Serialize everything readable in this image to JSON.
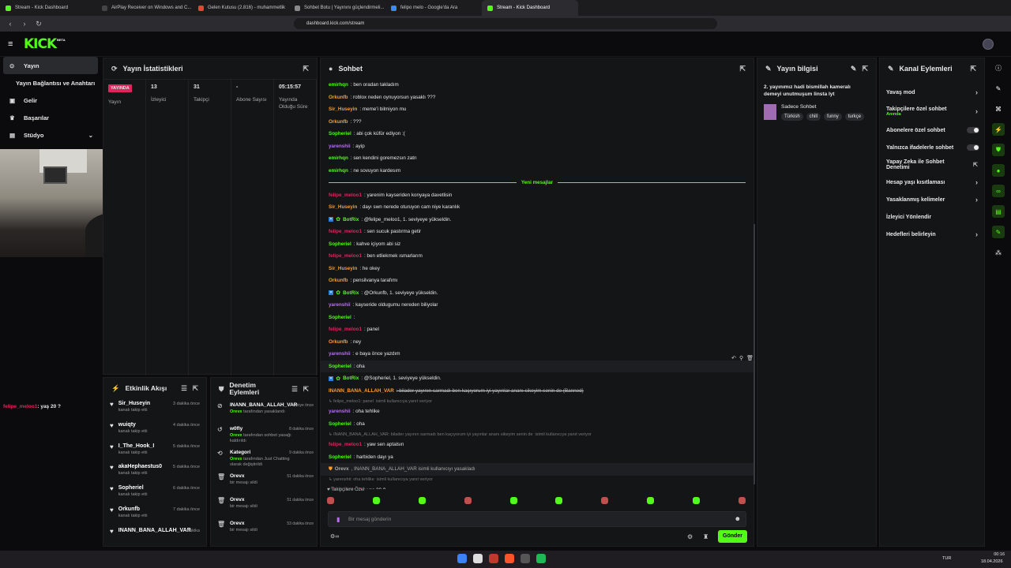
{
  "browser": {
    "tabs": [
      {
        "label": "Stream - Kick Dashboard",
        "color": "#53fc18"
      },
      {
        "label": "AirPlay Receiver on Windows and C...",
        "color": "#444"
      },
      {
        "label": "Gelen Kutusu (2.816) - muhammetlik",
        "color": "#ea4335"
      },
      {
        "label": "Sohbet Botu | Yayınını güçlendirmeli...",
        "color": "#888"
      },
      {
        "label": "felipo melo - Google'da Ara",
        "color": "#4285f4"
      },
      {
        "label": "Stream - Kick Dashboard",
        "color": "#53fc18"
      }
    ],
    "url": "dashboard.kick.com/stream"
  },
  "logo": "KICK",
  "logo_badge": "BETA",
  "sidebar": {
    "items": [
      {
        "label": "Yayın",
        "icon": "stream-icon"
      },
      {
        "label": "Yayın Bağlantısı ve Anahtarı",
        "icon": ""
      },
      {
        "label": "Gelir",
        "icon": "wallet-icon"
      },
      {
        "label": "Başarılar",
        "icon": "trophy-icon"
      },
      {
        "label": "Stüdyo",
        "icon": "studio-icon"
      }
    ],
    "chat_overlay": {
      "user": "felipe_meloo1",
      "text": ": yaş 20 ?"
    }
  },
  "stats": {
    "title": "Yayın İstatistikleri",
    "items": [
      {
        "value": "YAYINDA",
        "label": "Yayın"
      },
      {
        "value": "13",
        "label": "İzleyici"
      },
      {
        "value": "31",
        "label": "Takipçi"
      },
      {
        "value": "-",
        "label": "Abone Sayısı"
      },
      {
        "value": "05:15:57",
        "label": "Yayında Olduğu Süre"
      }
    ]
  },
  "activity": {
    "title": "Etkinlik Akışı",
    "items": [
      {
        "name": "Sir_Huseyin",
        "sub": "kanalı takip etti",
        "time": "3 dakika önce"
      },
      {
        "name": "wuiqty",
        "sub": "kanalı takip etti",
        "time": "4 dakika önce"
      },
      {
        "name": "I_The_Hook_I",
        "sub": "kanalı takip etti",
        "time": "5 dakika önce"
      },
      {
        "name": "akaHephaestus0",
        "sub": "kanalı takip etti",
        "time": "5 dakika önce"
      },
      {
        "name": "Sopheriel",
        "sub": "kanalı takip etti",
        "time": "6 dakika önce"
      },
      {
        "name": "Orkunfb",
        "sub": "kanalı takip etti",
        "time": "7 dakika önce"
      },
      {
        "name": "INANN_BANA_ALLAH_VAR",
        "sub": "",
        "time": "dakika"
      }
    ]
  },
  "moderation": {
    "title": "Denetim Eylemleri",
    "items": [
      {
        "name": "INANN_BANA_ALLAH_VAR",
        "sub1": "Orevx",
        "sub2": " tarafından yasaklandı",
        "time": "saniye önce"
      },
      {
        "name": "w0fly",
        "sub1": "Orevx",
        "sub2": " tarafından sohbet yasağı kaldırıldı",
        "time": "8 dakika önce"
      },
      {
        "name": "Kategori",
        "sub1": "Orevx",
        "sub2": " tarafından Just Chatting olarak değiştirildi",
        "time": "9 dakika önce"
      },
      {
        "name": "Orevx",
        "sub1": "",
        "sub2": "bir mesajı sildi",
        "time": "51 dakika önce"
      },
      {
        "name": "Orevx",
        "sub1": "",
        "sub2": "bir mesajı sildi",
        "time": "51 dakika önce"
      },
      {
        "name": "Orevx",
        "sub1": "",
        "sub2": "bir mesajı sildi",
        "time": "53 dakika önce"
      }
    ]
  },
  "chat": {
    "title": "Sohbet",
    "new_messages": "Yeni mesajlar",
    "placeholder": "Bir mesaj gönderin",
    "send": "Gönder",
    "followers_only": "Takipçilere Özel",
    "lines": [
      {
        "user": "emirhqn",
        "cls": "u-g",
        "text": ": ben oradan takladım"
      },
      {
        "user": "Orkunfb",
        "cls": "u-o",
        "text": ": roblox neden oynuyorsun yasaklı ???"
      },
      {
        "user": "Sir_Huseyin",
        "cls": "u-o",
        "text": ": meme'i bilmiyon mu"
      },
      {
        "user": "Orkunfb",
        "cls": "u-o",
        "text": ": ???"
      },
      {
        "user": "Sopheriel",
        "cls": "u-gr",
        "text": ": abi çok küfür ediyon :("
      },
      {
        "user": "yarenshii",
        "cls": "u-p",
        "text": ": ayip"
      },
      {
        "user": "emirhqn",
        "cls": "u-g",
        "text": ": sen kendini goremezsın zatn"
      },
      {
        "user": "emirhqn",
        "cls": "u-g",
        "text": ": ne sovuyon kardesım"
      },
      {
        "user": "__NEW__",
        "cls": "",
        "text": ""
      },
      {
        "user": "felipe_meloo1",
        "cls": "u-r",
        "text": ": yarenim kayseriden konyaya davetlisin"
      },
      {
        "user": "Sir_Huseyin",
        "cls": "u-o",
        "text": ": dayı swn nerede oturuyon cam niye karanlık"
      },
      {
        "user": "BotRix",
        "cls": "u-g",
        "text": ": @felipe_meloo1, 1. seviyeye yükseldin."
      },
      {
        "user": "felipe_meloo1",
        "cls": "u-r",
        "text": ": sen sucuk pastırma getir"
      },
      {
        "user": "Sopheriel",
        "cls": "u-gr",
        "text": ": kahve içiyom abi siz"
      },
      {
        "user": "felipe_meloo1",
        "cls": "u-r",
        "text": ": ben etliekmek ısmarlarım"
      },
      {
        "user": "Sir_Huseyin",
        "cls": "u-o",
        "text": ": he okey"
      },
      {
        "user": "Orkunfb",
        "cls": "u-o",
        "text": ": pensilvanya tarafımı"
      },
      {
        "user": "BotRix",
        "cls": "u-g",
        "text": ": @Orkunfb, 1. seviyeye yükseldin."
      },
      {
        "user": "yarenshii",
        "cls": "u-p",
        "text": ": kayseride oldugumu nereden biliyolar"
      },
      {
        "user": "Sopheriel",
        "cls": "u-gr",
        "text": ":"
      },
      {
        "user": "felipe_meloo1",
        "cls": "u-r",
        "text": ": panel"
      },
      {
        "user": "Orkunfb",
        "cls": "u-o",
        "text": ": ney"
      },
      {
        "user": "yarenshii",
        "cls": "u-p",
        "text": ": e baya önce yazdım"
      },
      {
        "user": "Sopheriel",
        "cls": "u-gr",
        "text": ": oha"
      },
      {
        "user": "BotRix",
        "cls": "u-g",
        "text": ": @Sopheriel, 1. seviyeye yükseldin."
      },
      {
        "user": "INANN_BANA_ALLAH_VAR",
        "cls": "u-o",
        "text": ": bilader yayının sarmadı ben kaçıyorum iyi yayınlar ananı sikeyim senin de (Banned)"
      },
      {
        "user": "↳ felipe_meloo1: panel",
        "cls": "reply",
        "text": " isimli kullanıcıya yanıt veriyor"
      },
      {
        "user": "yarenshii",
        "cls": "u-p",
        "text": ": oha tehlike"
      },
      {
        "user": "Sopheriel",
        "cls": "u-gr",
        "text": ": oha"
      },
      {
        "user": "↳ INANN_BANA_ALLAH_VAR: bilader yayının sarmadı ben kaçıyorum iyi yayınlar ananı sikeyim senin de",
        "cls": "reply",
        "text": " isimli kullanıcıya yanıt veriyor"
      },
      {
        "user": "felipe_meloo1",
        "cls": "u-r",
        "text": ": yaw sen aptalsın"
      },
      {
        "user": "Sopheriel",
        "cls": "u-gr",
        "text": ": harbiden dayı ya"
      },
      {
        "user": "Orevx",
        "cls": "mod",
        "text": ", INANN_BANA_ALLAH_VAR isimli kullanıcıyı yasakladı"
      },
      {
        "user": "↳ yarenshii: oha tehlike",
        "cls": "reply",
        "text": " isimli kullanıcıya yanıt veriyor"
      },
      {
        "user": "felipe_meloo1",
        "cls": "u-r",
        "text": ": yaş 20 ?"
      }
    ]
  },
  "info": {
    "title": "Yayın bilgisi",
    "stream_title": "2. yayınımız hadi bismillah kameralı demeyi unutmuşum linsta lyt",
    "category": "Sadece Sohbet",
    "tags": [
      "Türkish",
      "chill",
      "funny",
      "turkçe"
    ]
  },
  "channel": {
    "title": "Kanal Eylemleri",
    "items": [
      {
        "label": "Yavaş mod",
        "kind": "chev",
        "sub": ""
      },
      {
        "label": "Takipçilere özel sohbet",
        "kind": "chev",
        "sub": "Anında"
      },
      {
        "label": "Abonelere özel sohbet",
        "kind": "toggle",
        "sub": ""
      },
      {
        "label": "Yalnızca ifadelerle sohbet",
        "kind": "toggle",
        "sub": ""
      },
      {
        "label": "Yapay Zeka ile Sohbet Denetimi",
        "kind": "ext",
        "sub": ""
      },
      {
        "label": "Hesap yaşı kısıtlaması",
        "kind": "chev",
        "sub": ""
      },
      {
        "label": "Yasaklanmış kelimeler",
        "kind": "chev",
        "sub": ""
      },
      {
        "label": "İzleyici Yönlendir",
        "kind": "none",
        "sub": ""
      },
      {
        "label": "Hedefleri belirleyin",
        "kind": "chev",
        "sub": ""
      }
    ]
  },
  "taskbar": {
    "lang": "TUR",
    "time": "00:16",
    "date": "18.04.2026"
  },
  "colors": {
    "accent": "#53fc18",
    "bg": "#0b0b0d",
    "panel": "#141517"
  }
}
